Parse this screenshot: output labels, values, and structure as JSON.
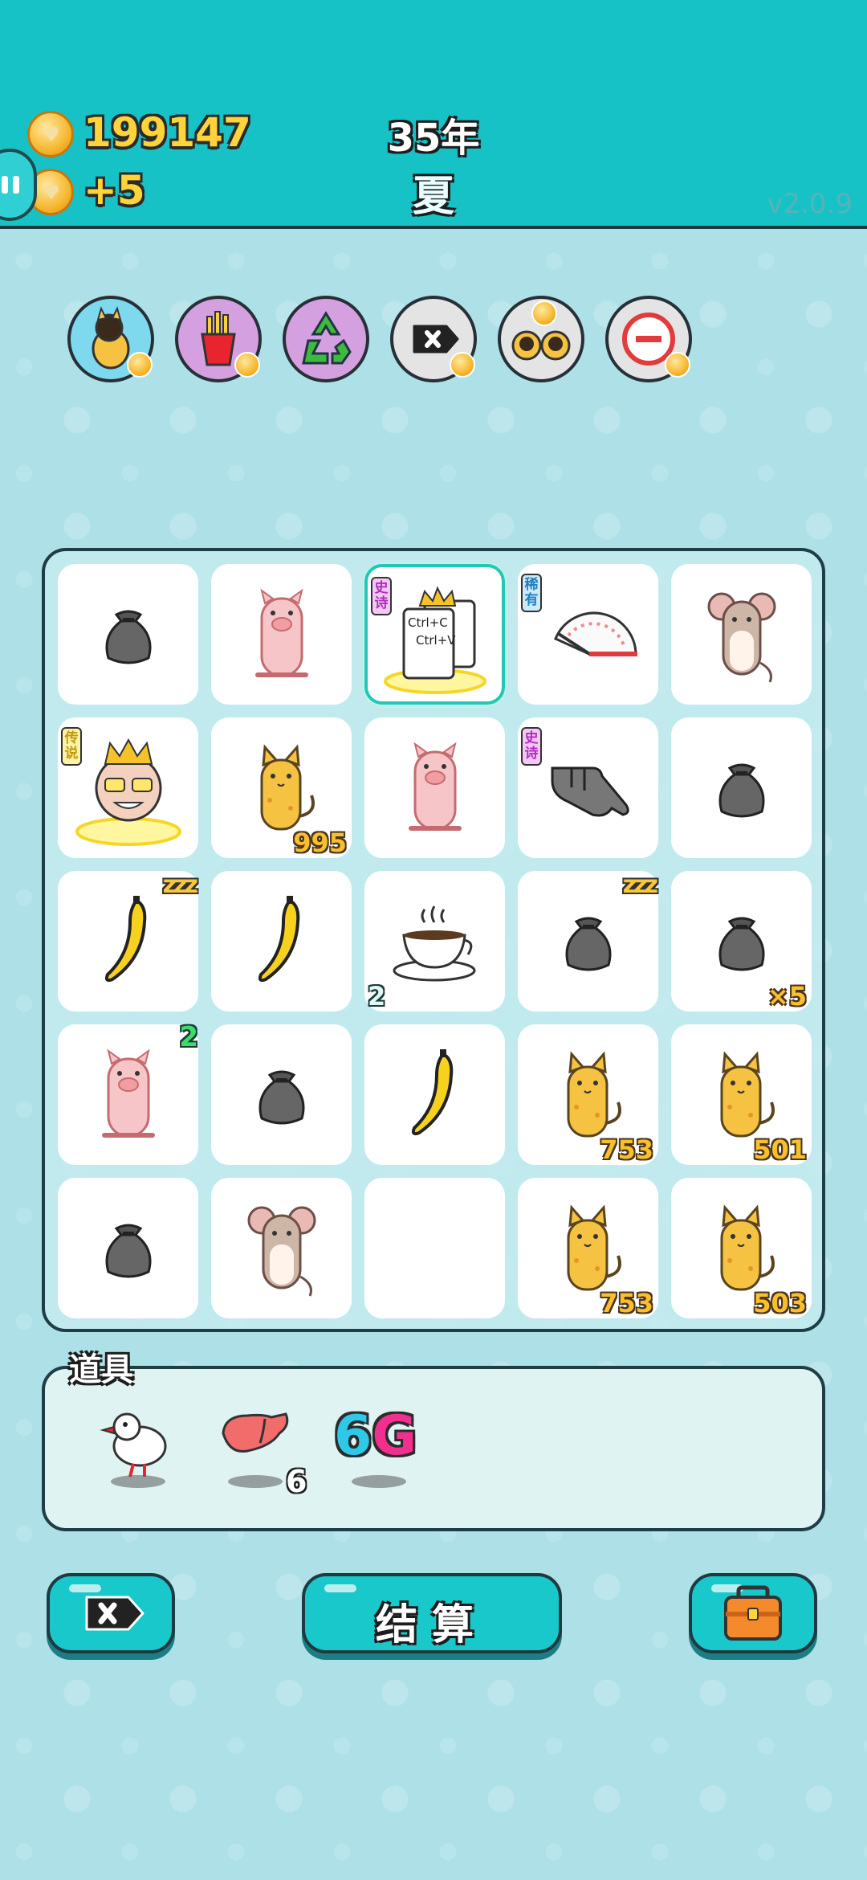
{
  "header": {
    "coins": "199147",
    "income": "+5",
    "year": "35年",
    "season": "夏",
    "version": "v2.0.9"
  },
  "skills": [
    {
      "icon": "cat-with-coin-icon"
    },
    {
      "icon": "fries-icon"
    },
    {
      "icon": "recycle-icon"
    },
    {
      "icon": "remove-tag-icon"
    },
    {
      "icon": "twin-cats-icon"
    },
    {
      "icon": "minus-circle-icon"
    }
  ],
  "board": {
    "cells": [
      {
        "icon": "garbage-bag"
      },
      {
        "icon": "pig"
      },
      {
        "icon": "ctrl-cv-king",
        "tag": "史诗",
        "card_text_1": "Ctrl+C",
        "card_text_2": "Ctrl+V",
        "selected": true
      },
      {
        "icon": "speedometer",
        "tag": "稀有"
      },
      {
        "icon": "mouse"
      },
      {
        "icon": "rich-king",
        "tag": "传说"
      },
      {
        "icon": "cat",
        "count": "995"
      },
      {
        "icon": "pig"
      },
      {
        "icon": "pointing-hand",
        "tag": "史诗"
      },
      {
        "icon": "garbage-bag"
      },
      {
        "icon": "banana",
        "zzz": "zzz"
      },
      {
        "icon": "banana"
      },
      {
        "icon": "coffee-cup",
        "left_num": "2"
      },
      {
        "icon": "garbage-bag",
        "zzz": "zzz"
      },
      {
        "icon": "garbage-bag",
        "count": "×5"
      },
      {
        "icon": "pig",
        "top_num": "2"
      },
      {
        "icon": "garbage-bag"
      },
      {
        "icon": "banana"
      },
      {
        "icon": "cat",
        "count": "753"
      },
      {
        "icon": "cat",
        "count": "501"
      },
      {
        "icon": "garbage-bag"
      },
      {
        "icon": "mouse"
      },
      {
        "icon": "empty"
      },
      {
        "icon": "cat",
        "count": "753"
      },
      {
        "icon": "cat",
        "count": "503"
      }
    ]
  },
  "items": {
    "label": "道具",
    "list": [
      {
        "icon": "white-bird-icon"
      },
      {
        "icon": "liver-icon",
        "count": "6"
      },
      {
        "icon": "6g-icon",
        "text_6": "6",
        "text_g": "G"
      }
    ]
  },
  "buttons": {
    "remove_icon": "remove-tag-icon",
    "settle_label": "结算",
    "bag_icon": "briefcase-icon"
  },
  "colors": {
    "header": "#17c2c7",
    "background": "#aee0e8",
    "coin_text": "#ffd43a",
    "count_text": "#f9c02c"
  }
}
